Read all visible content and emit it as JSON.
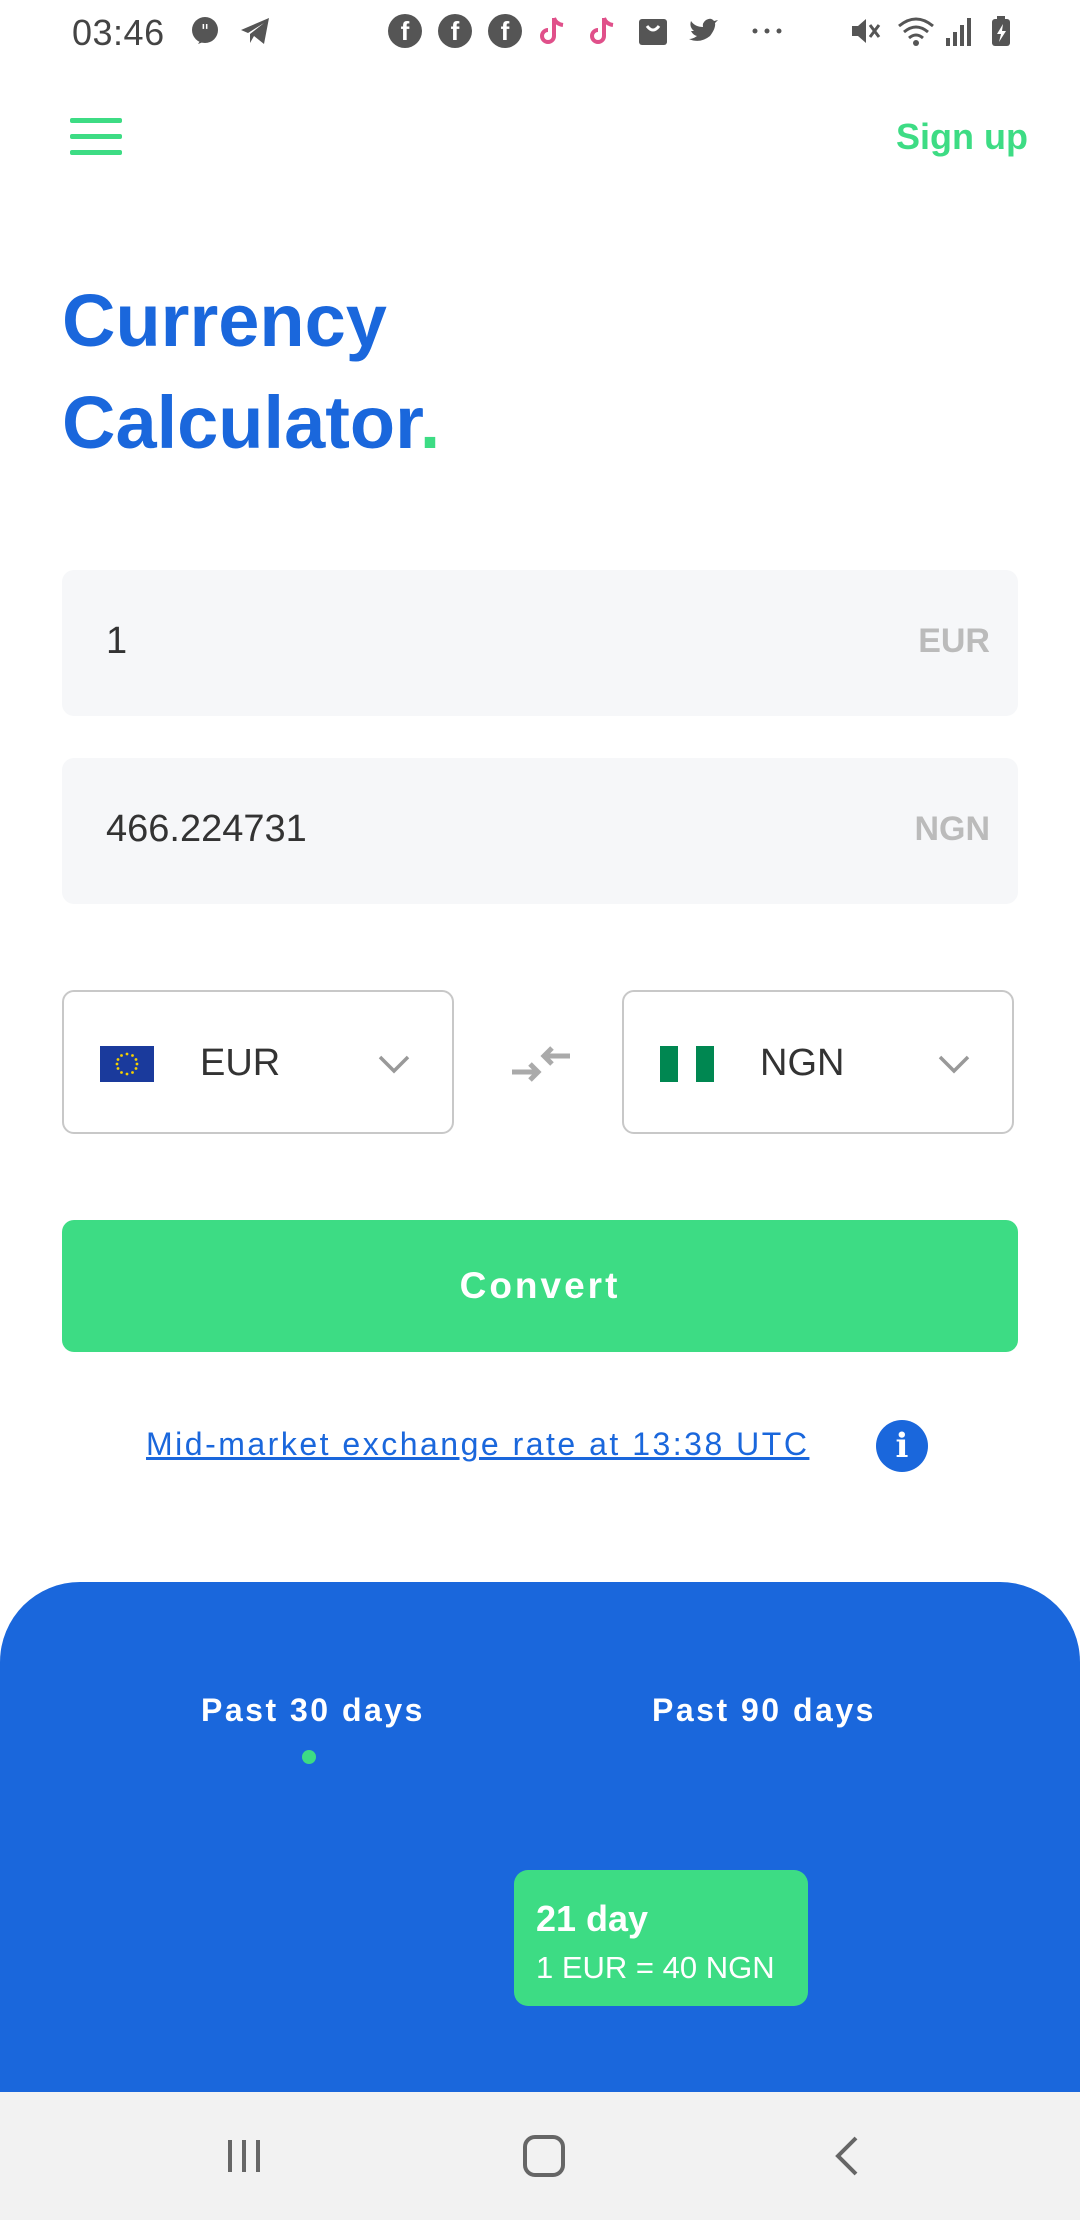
{
  "status_bar": {
    "time": "03:46",
    "icons": [
      "message-icon",
      "telegram-icon",
      "facebook-icon",
      "facebook-icon",
      "facebook-icon",
      "tiktok-icon",
      "tiktok-icon",
      "shopping-icon",
      "twitter-icon",
      "more-icon",
      "mute-icon",
      "wifi-icon",
      "signal-icon",
      "battery-icon"
    ]
  },
  "header": {
    "sign_up": "Sign up"
  },
  "title": {
    "line1": "Currency",
    "line2": "Calculator",
    "dot": "."
  },
  "converter": {
    "from_amount": "1",
    "from_currency_suffix": "EUR",
    "to_amount": "466.224731",
    "to_currency_suffix": "NGN",
    "from_select": "EUR",
    "to_select": "NGN",
    "convert_label": "Convert",
    "rate_link": "Mid-market exchange rate at 13:38 UTC",
    "info_label": "i"
  },
  "chart": {
    "tabs": [
      "Past 30 days",
      "Past 90 days"
    ],
    "active_tab": 0,
    "tooltip_title": "21 day",
    "tooltip_rate": "1 EUR = 40 NGN"
  },
  "colors": {
    "brand_blue": "#1a67dc",
    "brand_green": "#3ddc84"
  }
}
